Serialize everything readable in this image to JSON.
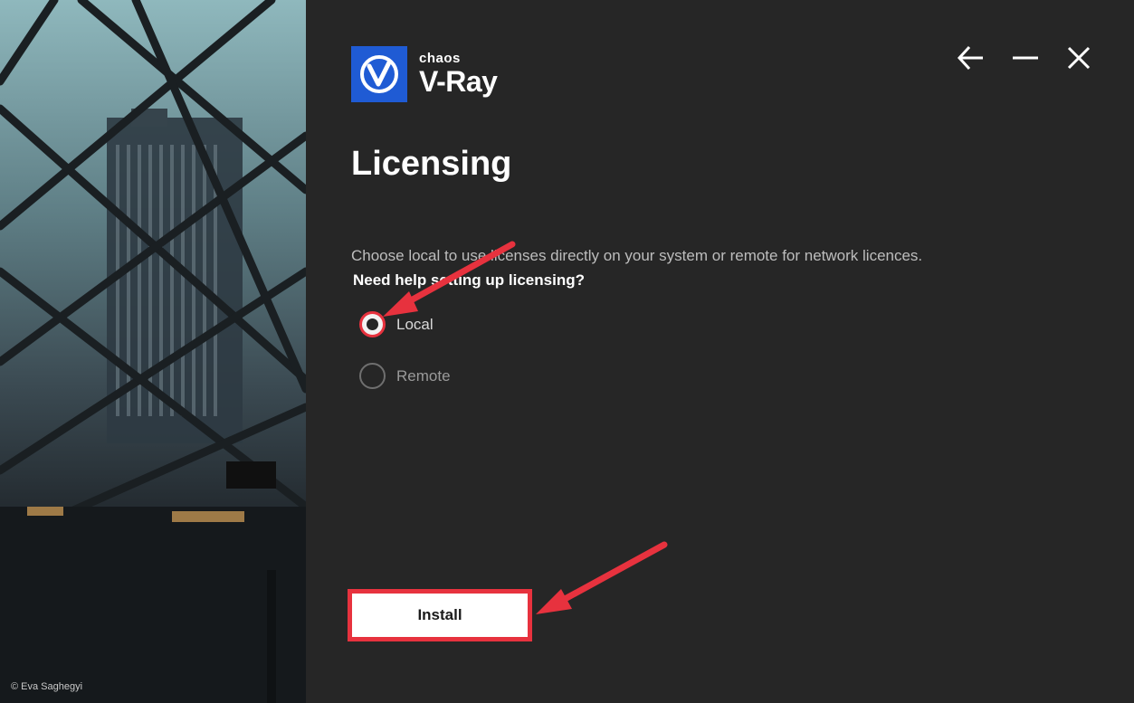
{
  "hero": {
    "credit": "© Eva Saghegyi"
  },
  "logo": {
    "brand": "chaos",
    "product": "V-Ray",
    "icon": "vray-v-icon",
    "color": "#1f5bd4"
  },
  "window_controls": {
    "back": "arrow-left-icon",
    "minimize": "minimize-icon",
    "close": "close-icon"
  },
  "page": {
    "title": "Licensing",
    "description": "Choose local to use licenses directly on your system or remote for network licences.",
    "help_link": "Need help setting up licensing?"
  },
  "license_options": [
    {
      "label": "Local",
      "selected": true
    },
    {
      "label": "Remote",
      "selected": false
    }
  ],
  "install_button": {
    "label": "Install"
  },
  "annotations": {
    "arrow_color": "#e7323e"
  }
}
